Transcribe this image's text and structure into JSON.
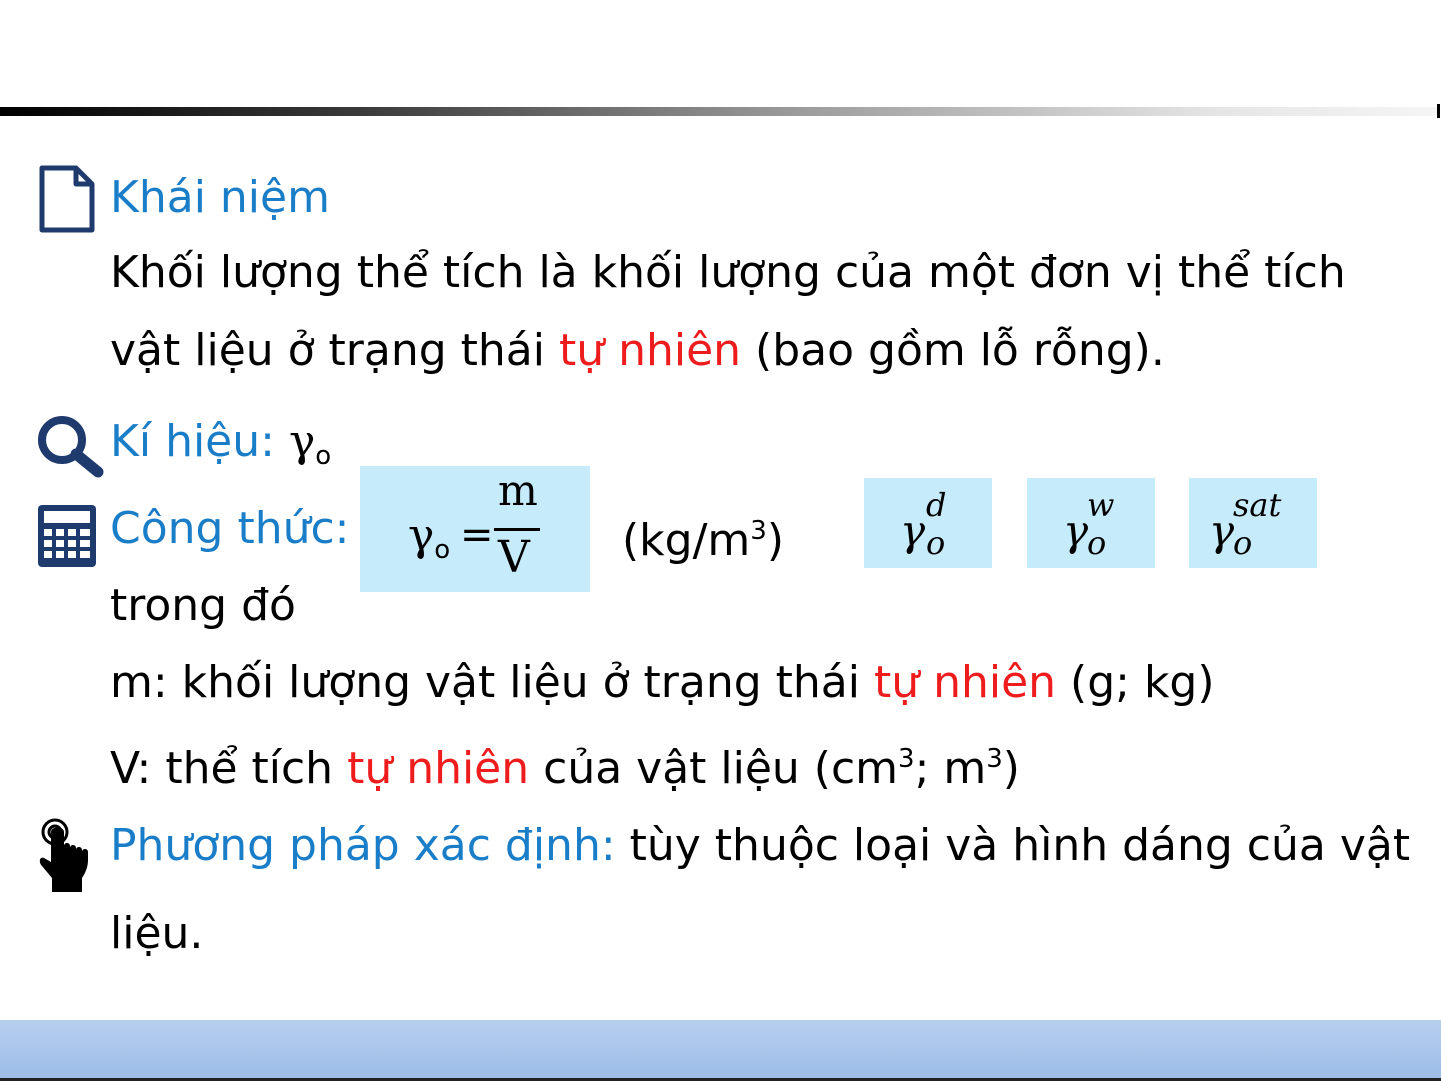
{
  "concept": {
    "heading": "Khái niệm",
    "body1": "Khối lượng thể tích là khối lượng của một đơn vị thể tích",
    "body2_a": "vật liệu ở trạng thái ",
    "body2_red": "tự nhiên",
    "body2_b": " (bao gồm lỗ rỗng)."
  },
  "symbol": {
    "label": "Kí hiệu: ",
    "gamma": "γ",
    "sub": "o"
  },
  "formula": {
    "label": "Công thức:",
    "gamma": "γ",
    "sub": "o",
    "equals": "=",
    "numerator": "m",
    "denominator": "V",
    "unit_a": "(kg/m",
    "unit_exp": "3",
    "unit_b": ")",
    "variants": [
      {
        "symbol": "γ",
        "sup": "d",
        "sub": "o"
      },
      {
        "symbol": "γ",
        "sup": "w",
        "sub": "o"
      },
      {
        "symbol": "γ",
        "sup": "sat",
        "sub": "o"
      }
    ]
  },
  "where": {
    "label": "trong đó",
    "m_a": "m: khối lượng vật liệu ở trạng thái ",
    "m_red": "tự nhiên",
    "m_b": " (g; kg)",
    "v_a": "V: thể tích ",
    "v_red": "tự nhiên",
    "v_b1": " của vật liệu (cm",
    "v_exp1": "3",
    "v_b2": "; m",
    "v_exp2": "3",
    "v_b3": ")"
  },
  "method": {
    "label": "Phương pháp xác định:",
    "text1": " tùy thuộc loại và hình dáng của vật",
    "text2": "liệu."
  },
  "colors": {
    "heading_blue": "#1a7dc8",
    "highlight_red": "#ee1c1c",
    "box_fill": "#c6ecfb",
    "icon_navy": "#1f3b6e"
  },
  "icons": [
    "document-icon",
    "search-icon",
    "calculator-icon",
    "pointing-hand-icon"
  ]
}
